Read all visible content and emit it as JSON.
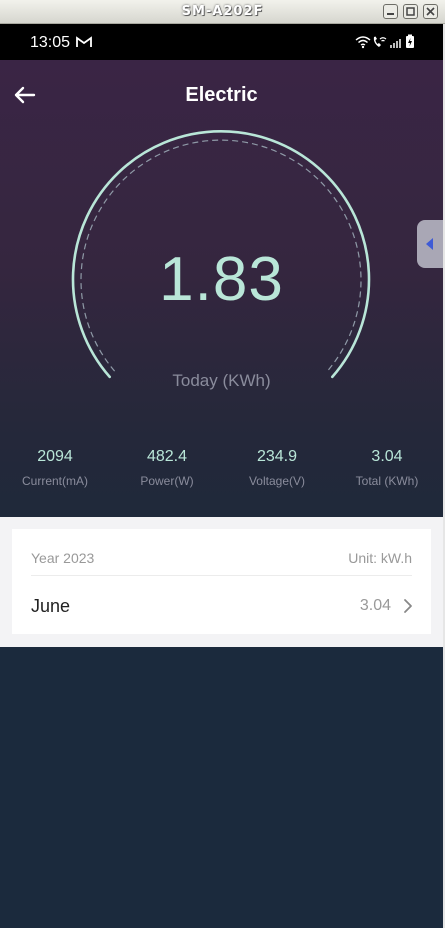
{
  "window": {
    "title": "SM-A202F"
  },
  "status_bar": {
    "time": "13:05"
  },
  "header": {
    "title": "Electric"
  },
  "gauge": {
    "value": "1.83",
    "label": "Today (KWh)"
  },
  "stats": [
    {
      "value": "2094",
      "label": "Current(mA)"
    },
    {
      "value": "482.4",
      "label": "Power(W)"
    },
    {
      "value": "234.9",
      "label": "Voltage(V)"
    },
    {
      "value": "3.04",
      "label": "Total (KWh)"
    }
  ],
  "card": {
    "year": "Year 2023",
    "unit": "Unit: kW.h",
    "rows": [
      {
        "month": "June",
        "value": "3.04"
      }
    ]
  },
  "colors": {
    "accent": "#b9e6d8",
    "muted": "#8a8c9c",
    "bg_dark": "#1b2a3d",
    "hero_top": "#3a2545"
  }
}
